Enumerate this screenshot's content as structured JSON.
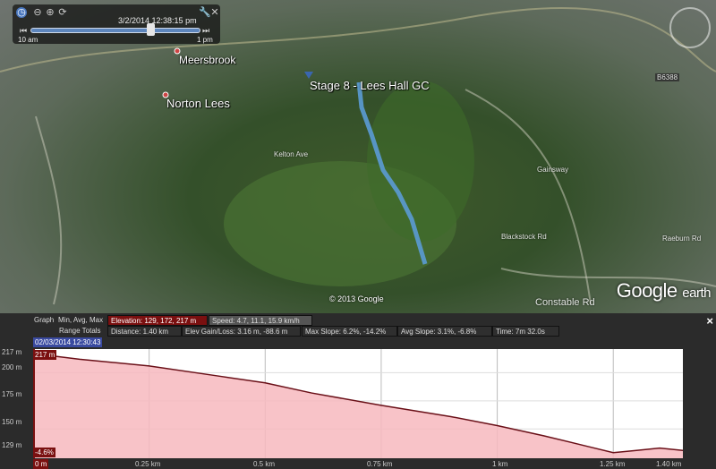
{
  "map": {
    "placemark": "Stage 8 - Lees Hall GC",
    "places": [
      "Meersbrook",
      "Norton Lees"
    ],
    "roads": [
      "Kelton Ave",
      "Constable Rd",
      "Gainsway",
      "Raeburn Rd",
      "Blackstock Rd",
      "B6388"
    ],
    "copyright": "© 2013 Google",
    "logo_main": "Google",
    "logo_sub": "earth",
    "route_color": "#5b9bd5"
  },
  "time_slider": {
    "timestamp": "3/2/2014  12:38:15 pm",
    "start": "10 am",
    "end": "1 pm",
    "position": 0.77
  },
  "graph": {
    "graph_label": "Graph",
    "minavgmax_label": "Min, Avg, Max",
    "elevation": "Elevation: 129, 172, 217 m",
    "speed": "Speed: 4.7, 11.1, 15.9 km/h",
    "range_totals_label": "Range Totals",
    "distance": "Distance: 1.40 km",
    "elev_gain_loss": "Elev Gain/Loss: 3.16 m, -88.6 m",
    "max_slope": "Max Slope: 6.2%, -14.2%",
    "avg_slope": "Avg Slope: 3.1%, -6.8%",
    "time": "Time: 7m 32.0s",
    "cursor_time": "02/03/2014 12:30:43",
    "cursor_elev": "217 m",
    "cursor_slope": "-4.6%",
    "cursor_dist": "0 m",
    "close": "×"
  },
  "chart_data": {
    "type": "area",
    "xlabel": "",
    "ylabel": "",
    "x_ticks": [
      "0.25 km",
      "0.5 km",
      "0.75 km",
      "1 km",
      "1.25 km",
      "1.40 km"
    ],
    "y_ticks": [
      "217 m",
      "200 m",
      "175 m",
      "150 m",
      "129 m"
    ],
    "xlim": [
      0,
      1.4
    ],
    "ylim": [
      124,
      221
    ],
    "x": [
      0,
      0.1,
      0.25,
      0.4,
      0.5,
      0.6,
      0.75,
      0.9,
      1.0,
      1.1,
      1.2,
      1.25,
      1.3,
      1.35,
      1.4
    ],
    "y": [
      217,
      212,
      206,
      197,
      191,
      182,
      171,
      161,
      153,
      144,
      134,
      129,
      131,
      133,
      131
    ],
    "fill_color": "#f7b9be",
    "line_color": "#6a1018"
  }
}
